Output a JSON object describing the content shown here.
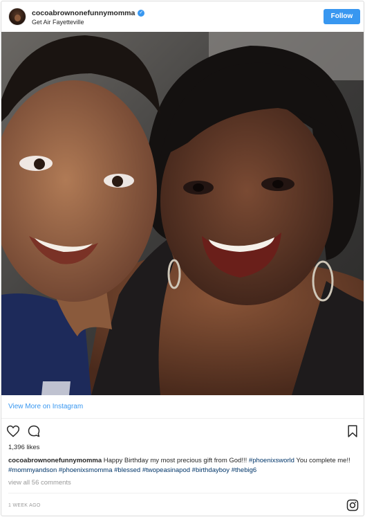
{
  "header": {
    "username": "cocoabrownonefunnymomma",
    "verified_mark": "✓",
    "location": "Get Air Fayetteville",
    "follow_label": "Follow"
  },
  "photo": {
    "icon": "post-photo"
  },
  "view_more": {
    "label": "View More on Instagram"
  },
  "actions": {
    "like_icon": "heart-icon",
    "comment_icon": "comment-icon",
    "save_icon": "bookmark-icon"
  },
  "likes": "1,396 likes",
  "caption": {
    "username": "cocoabrownonefunnymomma",
    "text": " Happy Birthday my most precious gift from God!!! ",
    "tag1": "#phoenixsworld",
    "text2": " You complete me!! ",
    "tag2": "#mommyandson",
    "tag3": "#phoenixsmomma",
    "tag4": "#blessed",
    "tag5": "#twopeasinapod",
    "tag6": "#birthdayboy",
    "tag7": "#thebig6"
  },
  "view_all_comments": "view all 56 comments",
  "timestamp": "1 WEEK AGO",
  "colors": {
    "accent": "#3897f0",
    "hashtag": "#003569",
    "muted": "#999999"
  }
}
